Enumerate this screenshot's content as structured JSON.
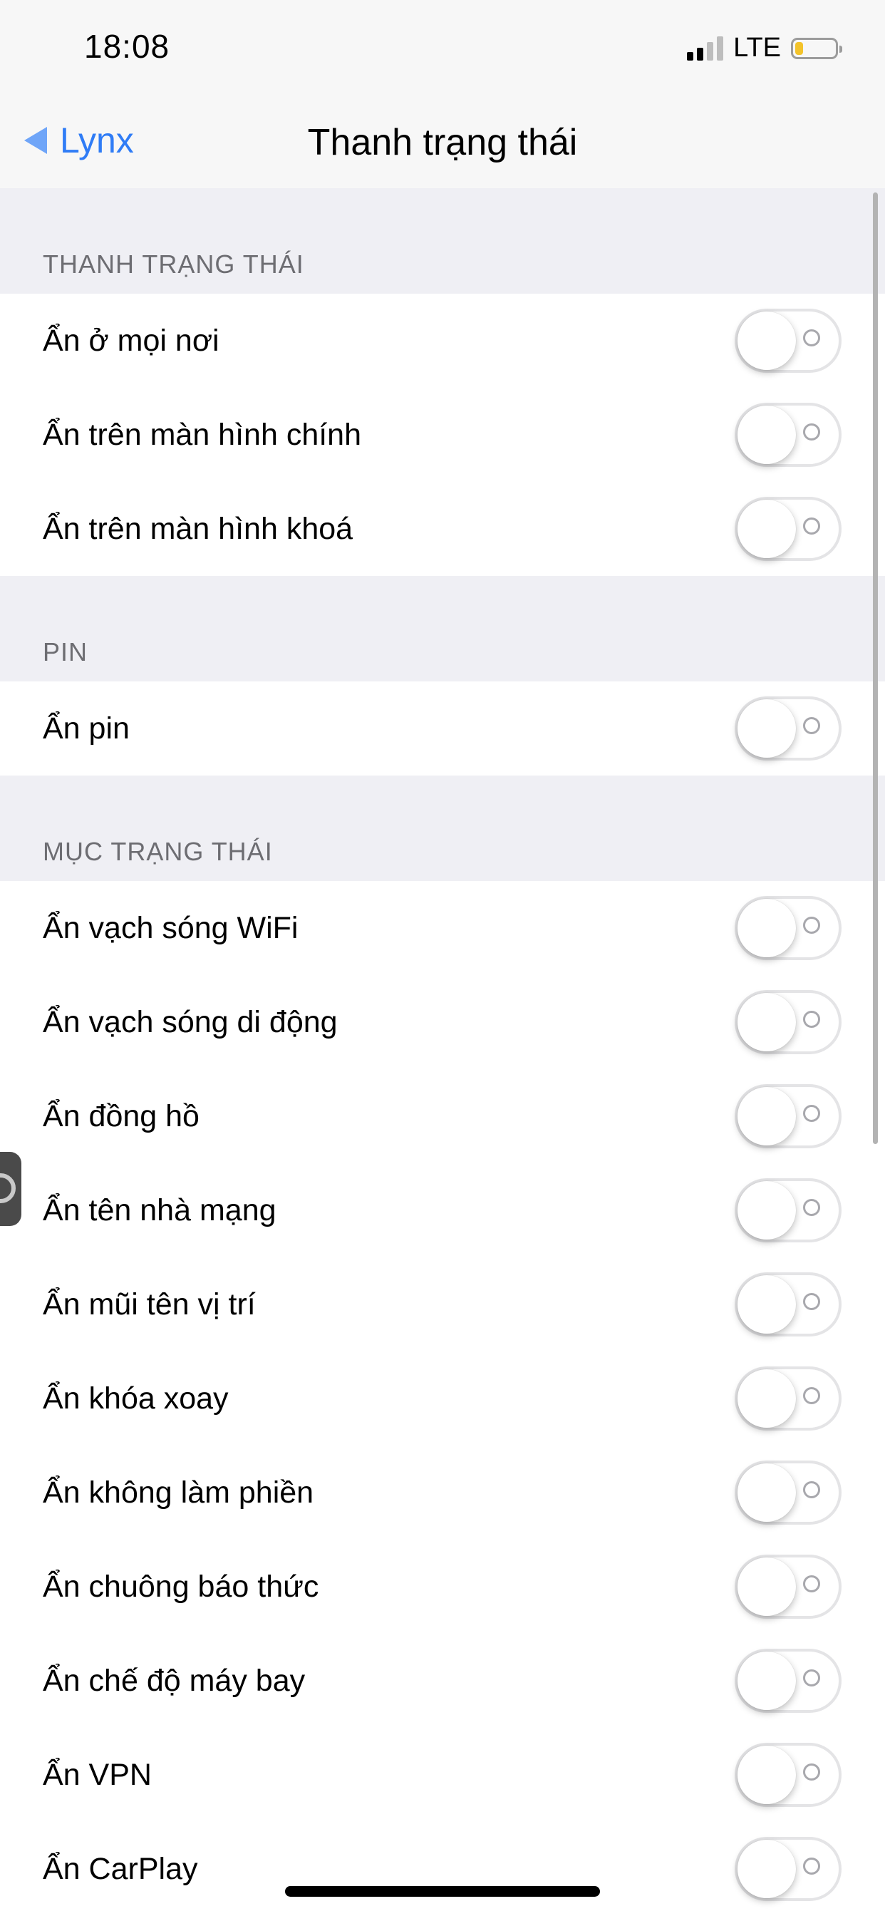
{
  "status_bar": {
    "time": "18:08",
    "network": "LTE",
    "signal_icon": "cellular-signal-icon",
    "battery_icon": "battery-icon",
    "battery_level": 0.2,
    "battery_color": "#f3c32b"
  },
  "nav": {
    "back_label": "Lynx",
    "title": "Thanh trạng thái",
    "accent_color": "#2f7cf6"
  },
  "sections": [
    {
      "header": "THANH TRẠNG THÁI",
      "rows": [
        {
          "label": "Ẩn ở mọi nơi",
          "on": false
        },
        {
          "label": "Ẩn trên màn hình chính",
          "on": false
        },
        {
          "label": "Ẩn trên màn hình khoá",
          "on": false
        }
      ]
    },
    {
      "header": "PIN",
      "rows": [
        {
          "label": "Ẩn pin",
          "on": false
        }
      ]
    },
    {
      "header": "MỤC TRẠNG THÁI",
      "rows": [
        {
          "label": "Ẩn vạch sóng WiFi",
          "on": false
        },
        {
          "label": "Ẩn vạch sóng di động",
          "on": false
        },
        {
          "label": "Ẩn đồng hồ",
          "on": false
        },
        {
          "label": "Ẩn tên nhà mạng",
          "on": false
        },
        {
          "label": "Ẩn mũi tên vị trí",
          "on": false
        },
        {
          "label": "Ẩn khóa xoay",
          "on": false
        },
        {
          "label": "Ẩn không làm phiền",
          "on": false
        },
        {
          "label": "Ẩn chuông báo thức",
          "on": false
        },
        {
          "label": "Ẩn chế độ máy bay",
          "on": false
        },
        {
          "label": "Ẩn VPN",
          "on": false
        },
        {
          "label": "Ẩn CarPlay",
          "on": false
        }
      ]
    }
  ]
}
